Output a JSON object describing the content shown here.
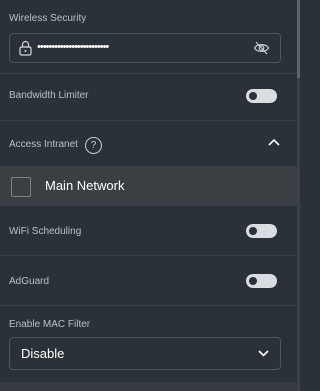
{
  "wireless_security": {
    "label": "Wireless Security",
    "password_masked": "•••••••••••••••••••••••••"
  },
  "bandwidth_limiter": {
    "label": "Bandwidth Limiter",
    "enabled": false
  },
  "access_intranet": {
    "label": "Access Intranet",
    "help_glyph": "?",
    "expanded": true
  },
  "networks": [
    {
      "label": "Main Network",
      "checked": false
    }
  ],
  "wifi_scheduling": {
    "label": "WiFi Scheduling",
    "enabled": false
  },
  "adguard": {
    "label": "AdGuard",
    "enabled": false
  },
  "mac_filter": {
    "label": "Enable MAC Filter",
    "selected": "Disable"
  },
  "colors": {
    "background": "#2b3138",
    "row_highlight": "#3a3f44",
    "toggle_track": "#d9dde1",
    "text_primary": "#ffffff",
    "text_secondary": "#b9c0c6"
  },
  "icons": [
    "lock-icon",
    "eye-off-icon",
    "help-icon",
    "chevron-up-icon",
    "chevron-down-icon"
  ]
}
